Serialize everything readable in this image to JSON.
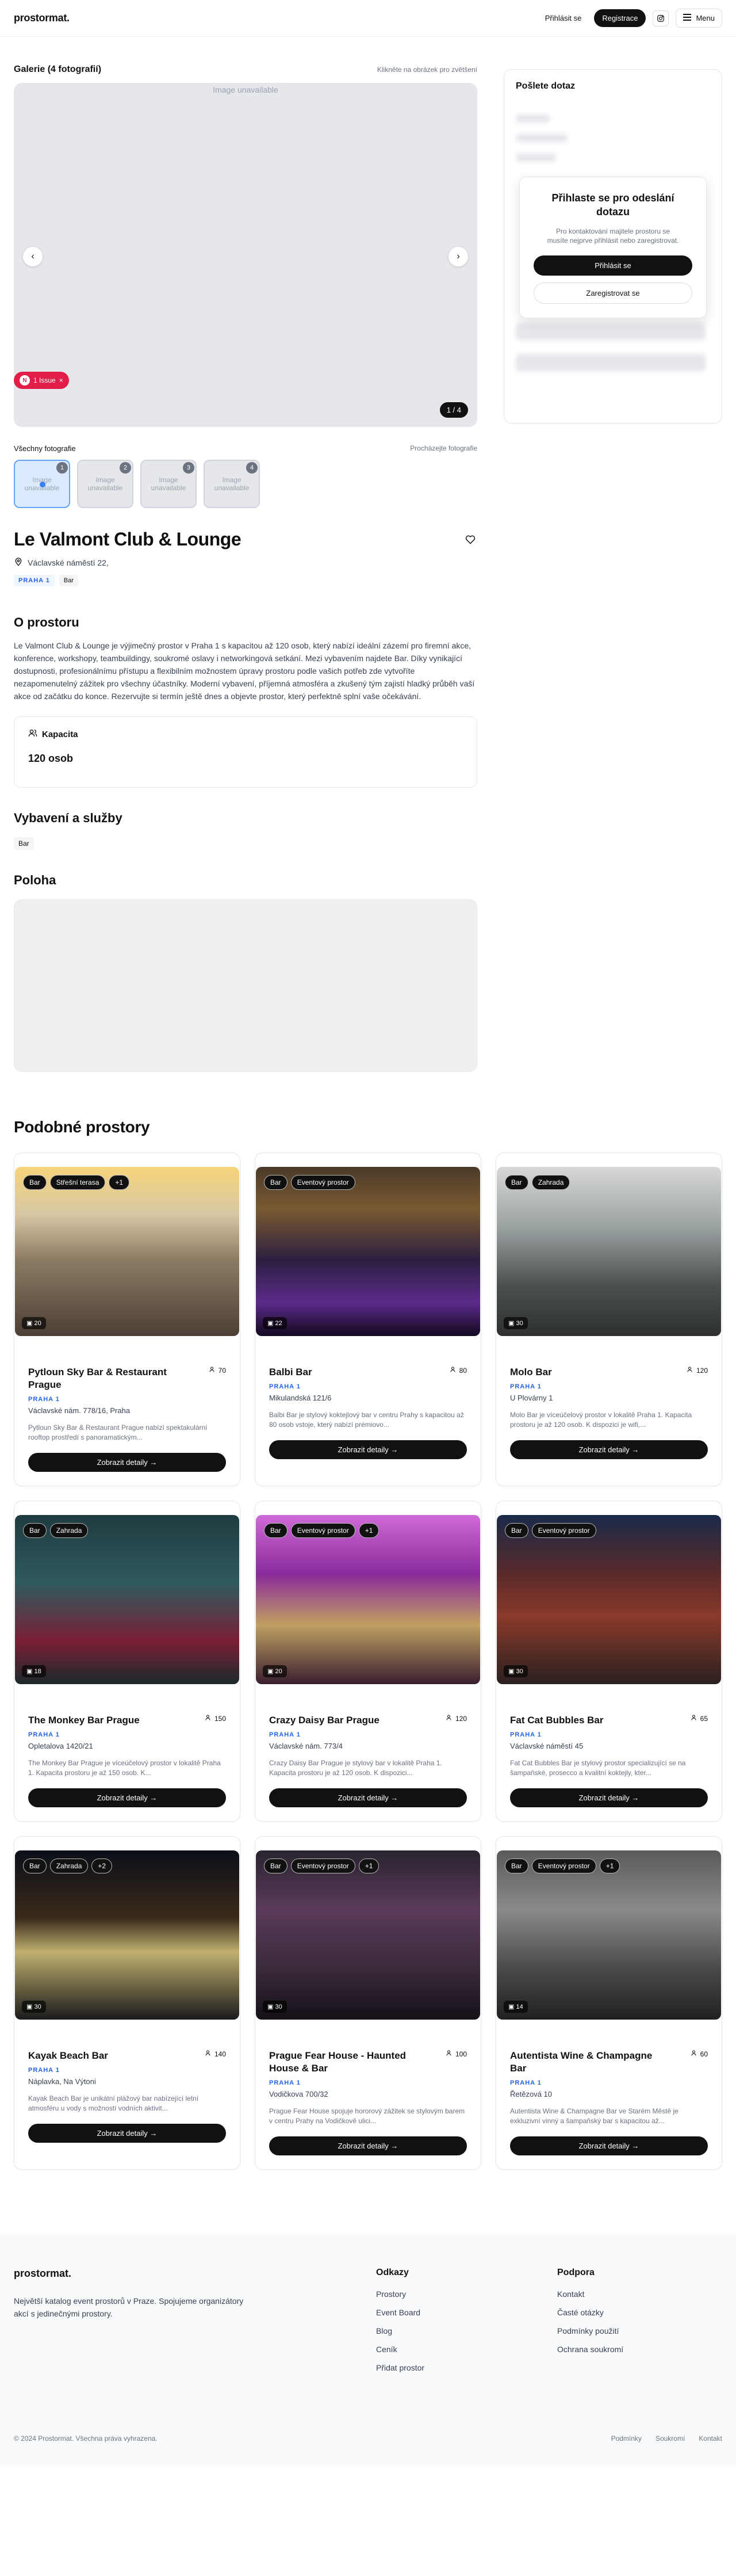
{
  "header": {
    "logo": "prostormat.",
    "login": "Přihlásit se",
    "register": "Registrace",
    "menu": "Menu"
  },
  "gallery": {
    "title": "Galerie (4 fotografií)",
    "hint": "Klikněte na obrázek pro zvětšení",
    "unavailable": "Image unavailable",
    "counter": "1 / 4",
    "issue_label": "1 Issue",
    "issue_n": "N",
    "all_photos": "Všechny fotografie",
    "browse": "Procházejte fotografie",
    "thumbs": [
      {
        "n": "1",
        "label": "Image unavailable"
      },
      {
        "n": "2",
        "label": "Image unavailable"
      },
      {
        "n": "3",
        "label": "Image unavailable"
      },
      {
        "n": "4",
        "label": "Image unavailable"
      }
    ]
  },
  "venue": {
    "name": "Le Valmont Club & Lounge",
    "address": "Václavské náměstí 22,",
    "district": "PRAHA 1",
    "type": "Bar"
  },
  "about": {
    "title": "O prostoru",
    "text": "Le Valmont Club & Lounge je výjimečný prostor v Praha 1 s kapacitou až 120 osob, který nabízí ideální zázemí pro firemní akce, konference, workshopy, teambuildingy, soukromé oslavy i networkingová setkání. Mezi vybavením najdete Bar. Díky vynikající dostupnosti, profesionálnímu přístupu a flexibilním možnostem úpravy prostoru podle vašich potřeb zde vytvoříte nezapomenutelný zážitek pro všechny účastníky. Moderní vybavení, příjemná atmosféra a zkušený tým zajistí hladký průběh vaší akce od začátku do konce. Rezervujte si termín ještě dnes a objevte prostor, který perfektně splní vaše očekávání."
  },
  "capacity": {
    "title": "Kapacita",
    "value": "120 osob"
  },
  "amenities": {
    "title": "Vybavení a služby",
    "items": [
      "Bar"
    ]
  },
  "location": {
    "title": "Poloha"
  },
  "sidebar": {
    "title": "Pošlete dotaz",
    "login_title": "Přihlaste se pro odeslání dotazu",
    "login_desc": "Pro kontaktování majitele prostoru se musíte nejprve přihlásit nebo zaregistrovat.",
    "login_btn": "Přihlásit se",
    "register_btn": "Zaregistrovat se"
  },
  "similar": {
    "title": "Podobné prostory",
    "button": "Zobrazit detaily",
    "cards": [
      {
        "tags": [
          "Bar",
          "Střešní terasa",
          "+1"
        ],
        "photos": "20",
        "name": "Pytloun Sky Bar & Restaurant Prague",
        "capacity": "70",
        "district": "PRAHA 1",
        "address": "Václavské nám. 778/16, Praha",
        "desc": "Pytloun Sky Bar & Restaurant Prague nabízí spektakulární rooftop prostředí s panoramatickým..."
      },
      {
        "tags": [
          "Bar",
          "Eventový prostor"
        ],
        "photos": "22",
        "name": "Balbi Bar",
        "capacity": "80",
        "district": "PRAHA 1",
        "address": "Mikulandská 121/6",
        "desc": "Balbi Bar je stylový koktejlový bar v centru Prahy s kapacitou až 80 osob vstoje, který nabízí prémiovo..."
      },
      {
        "tags": [
          "Bar",
          "Zahrada"
        ],
        "photos": "30",
        "name": "Molo Bar",
        "capacity": "120",
        "district": "PRAHA 1",
        "address": "U Plovárny 1",
        "desc": "Molo Bar je víceúčelový prostor v lokalitě Praha 1. Kapacita prostoru je až 120 osob. K dispozici je wifi,..."
      },
      {
        "tags": [
          "Bar",
          "Zahrada"
        ],
        "photos": "18",
        "name": "The Monkey Bar Prague",
        "capacity": "150",
        "district": "PRAHA 1",
        "address": "Opletalova 1420/21",
        "desc": "The Monkey Bar Prague je víceúčelový prostor v lokalitě Praha 1. Kapacita prostoru je až 150 osob. K..."
      },
      {
        "tags": [
          "Bar",
          "Eventový prostor",
          "+1"
        ],
        "photos": "20",
        "name": "Crazy Daisy Bar Prague",
        "capacity": "120",
        "district": "PRAHA 1",
        "address": "Václavské nám. 773/4",
        "desc": "Crazy Daisy Bar Prague je stylový bar v lokalitě Praha 1. Kapacita prostoru je až 120 osob. K dispozici..."
      },
      {
        "tags": [
          "Bar",
          "Eventový prostor"
        ],
        "photos": "30",
        "name": "Fat Cat Bubbles Bar",
        "capacity": "65",
        "district": "PRAHA 1",
        "address": "Václavské náměstí 45",
        "desc": "Fat Cat Bubbles Bar je stylový prostor specializující se na šampaňské, prosecco a kvalitní koktejly, kter..."
      },
      {
        "tags": [
          "Bar",
          "Zahrada",
          "+2"
        ],
        "photos": "30",
        "name": "Kayak Beach Bar",
        "capacity": "140",
        "district": "PRAHA 1",
        "address": "Náplavka, Na Výtoni",
        "desc": "Kayak Beach Bar je unikátní plážový bar nabízející letní atmosféru u vody s možností vodních aktivit..."
      },
      {
        "tags": [
          "Bar",
          "Eventový prostor",
          "+1"
        ],
        "photos": "30",
        "name": "Prague Fear House - Haunted House & Bar",
        "capacity": "100",
        "district": "PRAHA 1",
        "address": "Vodičkova 700/32",
        "desc": "Prague Fear House spojuje hororový zážitek se stylovým barem v centru Prahy na Vodičkově ulici..."
      },
      {
        "tags": [
          "Bar",
          "Eventový prostor",
          "+1"
        ],
        "photos": "14",
        "name": "Autentista Wine & Champagne Bar",
        "capacity": "60",
        "district": "PRAHA 1",
        "address": "Řetězová 10",
        "desc": "Autentista Wine & Champagne Bar ve Starém Městě je exkluzivní vinný a šampaňský bar s kapacitou až..."
      }
    ]
  },
  "footer": {
    "logo": "prostormat.",
    "about": "Největší katalog event prostorů v Praze. Spojujeme organizátory akcí s jedinečnými prostory.",
    "col1_title": "Odkazy",
    "col1_links": [
      "Prostory",
      "Event Board",
      "Blog",
      "Ceník",
      "Přidat prostor"
    ],
    "col2_title": "Podpora",
    "col2_links": [
      "Kontakt",
      "Časté otázky",
      "Podmínky použití",
      "Ochrana soukromí"
    ],
    "copyright": "© 2024 Prostormat. Všechna práva vyhrazena.",
    "bottom_links": [
      "Podmínky",
      "Soukromí",
      "Kontakt"
    ]
  }
}
